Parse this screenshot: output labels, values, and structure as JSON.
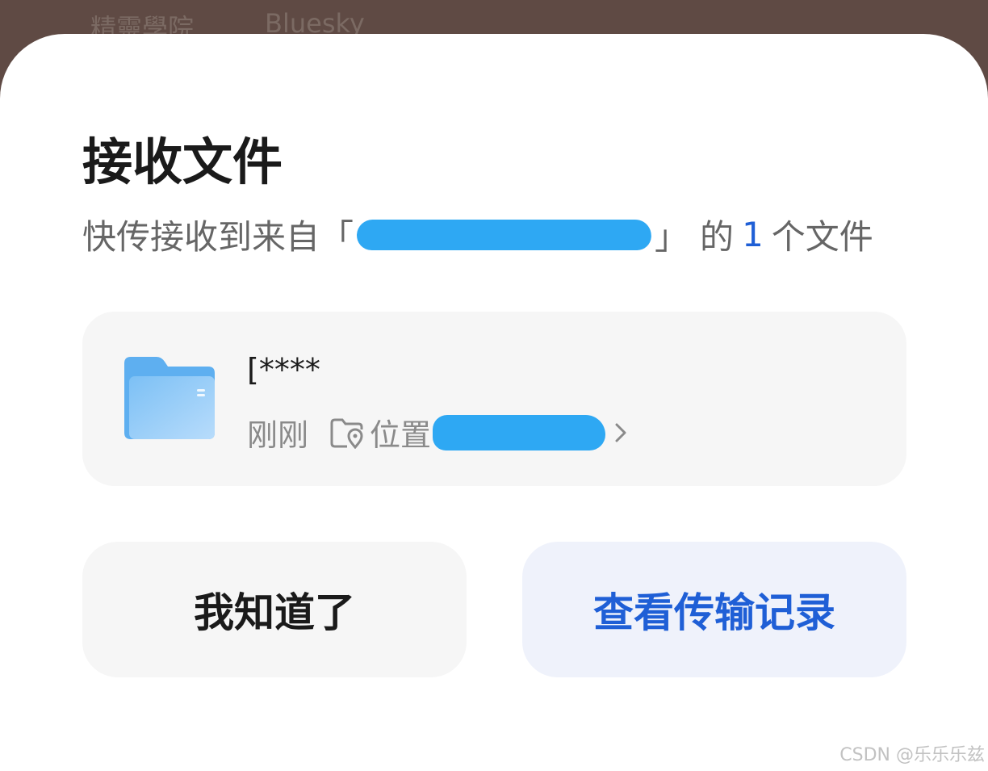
{
  "background": {
    "tabs": [
      "精靈學院",
      "Bluesky"
    ]
  },
  "dialog": {
    "title": "接收文件",
    "subtitle": {
      "prefix": "快传接收到来自",
      "open_bracket": "「",
      "close_bracket": "」",
      "middle": "的",
      "count": "1",
      "suffix": "个文件"
    },
    "file": {
      "name": "[****",
      "time": "刚刚",
      "location_label": "位置",
      "icon": "folder-icon"
    },
    "buttons": {
      "dismiss": "我知道了",
      "view_history": "查看传输记录"
    }
  },
  "watermark": "CSDN @乐乐乐兹",
  "colors": {
    "accent": "#1f5fd6",
    "redaction": "#2ea8f3",
    "card_bg": "#f6f6f6",
    "primary_btn_bg": "#eff2fb"
  }
}
